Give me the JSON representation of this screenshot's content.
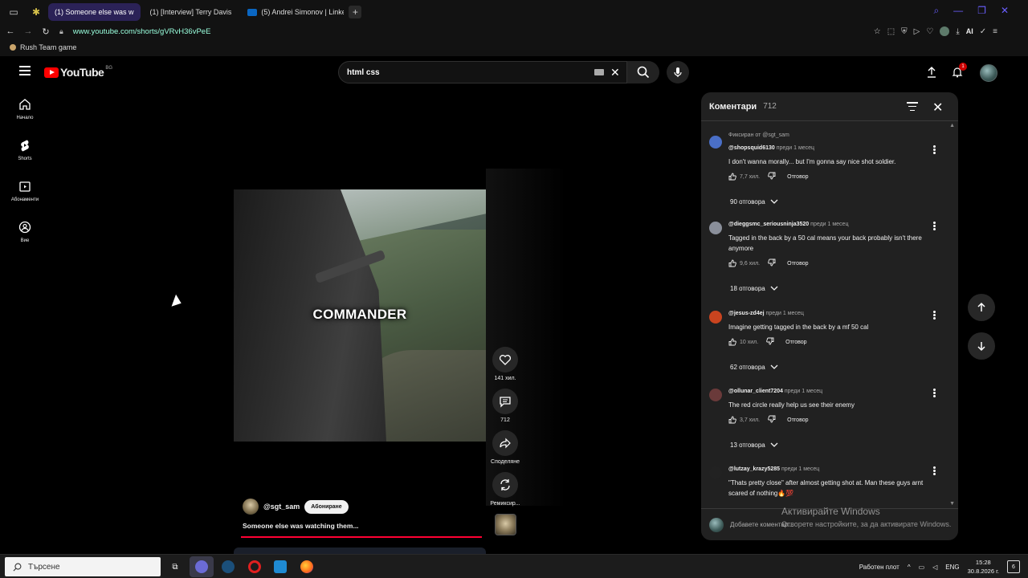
{
  "browser": {
    "tabs": [
      {
        "label": "(1) Someone else was w",
        "active": true,
        "favicon": "youtube"
      },
      {
        "label": "(1) [Interview] Terry Davis",
        "active": false,
        "favicon": "youtube"
      },
      {
        "label": "(5) Andrei Simonov | Linked",
        "active": false,
        "favicon": "linkedin"
      }
    ],
    "url": "www.youtube.com/shorts/gVRvH36vPeE",
    "bookmark": "Rush Team game",
    "ext_ai": "AI"
  },
  "youtube": {
    "logo_text": "YouTube",
    "country_code": "BG",
    "search": {
      "value": "html css"
    },
    "notification_count": "1",
    "rail": [
      {
        "label": "Начало",
        "icon": "home-icon"
      },
      {
        "label": "Shorts",
        "icon": "shorts-icon"
      },
      {
        "label": "Абонаменти",
        "icon": "subscriptions-icon"
      },
      {
        "label": "Вие",
        "icon": "you-icon"
      }
    ]
  },
  "short": {
    "caption": "COMMANDER",
    "likes": "141 хил.",
    "comments": "712",
    "share_label": "Споделяне",
    "remix_label": "Ремиксир...",
    "channel": "@sgt_sam",
    "subscribe_label": "Абониране",
    "title": "Someone else was watching them...",
    "progress": 1.0
  },
  "comments_panel": {
    "title": "Коментари",
    "count": "712",
    "reply_label": "Отговор",
    "add_placeholder": "Добавете коментар...",
    "items": [
      {
        "pinned": "Фиксиран от @sgt_sam",
        "author": "@shopsquid6130",
        "time": "преди 1 месец",
        "text": "I don't wanna morally... but I'm gonna say nice shot soldier.",
        "likes": "7,7 хил.",
        "replies": "90 отговора",
        "avatar_color": "#4a6fc7"
      },
      {
        "pinned": "",
        "author": "@dieggsmc_seriousninja3520",
        "time": "преди 1 месец",
        "text": "Tagged in the back by a 50 cal means your back probably isn't there anymore",
        "likes": "9,6 хил.",
        "replies": "18 отговора",
        "avatar_color": "#8a8f9a"
      },
      {
        "pinned": "",
        "author": "@jesus-zd4ej",
        "time": "преди 1 месец",
        "text": "Imagine getting tagged in the back by a mf 50 cal",
        "likes": "10 хил.",
        "replies": "62 отговора",
        "avatar_color": "#c9441f"
      },
      {
        "pinned": "",
        "author": "@ollunar_client7204",
        "time": "преди 1 месец",
        "text": "The red circle really help us see their enemy",
        "likes": "3,7 хил.",
        "replies": "13 отговора",
        "avatar_color": "#6a3a3a"
      },
      {
        "pinned": "",
        "author": "@lutzay_krazy5285",
        "time": "преди 1 месец",
        "text": "\"Thats pretty close\" after almost getting shot at. Man these guys arnt scared of nothing🔥💯",
        "likes": "",
        "replies": "",
        "avatar_color": "#222222"
      }
    ]
  },
  "watermark": {
    "line1": "Активирайте Windows",
    "line2": "Отворете настройките, за да активирате Windows."
  },
  "taskbar": {
    "search_placeholder": "Търсене",
    "desktop_label": "Работен плот",
    "lang": "ENG",
    "time": "15:28",
    "date": "30.8.2026 г.",
    "notifications": "6"
  }
}
